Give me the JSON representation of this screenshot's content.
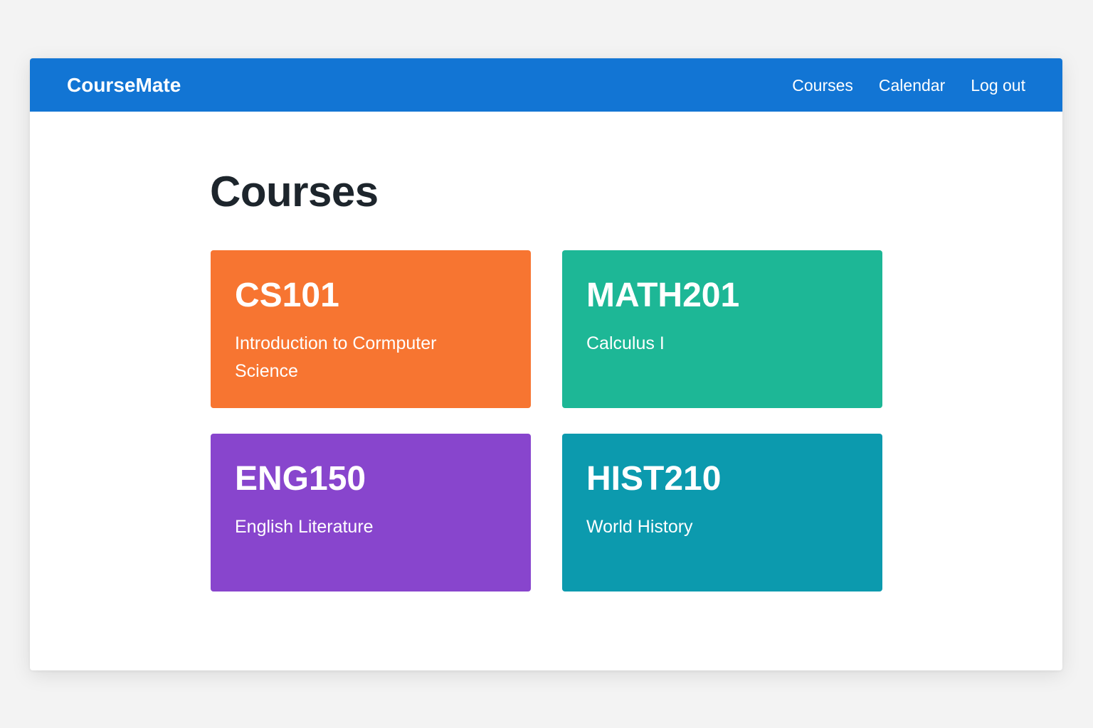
{
  "header": {
    "brand": "CourseMate",
    "nav": [
      {
        "label": "Courses"
      },
      {
        "label": "Calendar"
      },
      {
        "label": "Log out"
      }
    ],
    "background_color": "#1275d4"
  },
  "main": {
    "title": "Courses",
    "courses": [
      {
        "code": "CS101",
        "name": "Introduction to Cormputer Science",
        "color": "#f77531"
      },
      {
        "code": "MATH201",
        "name": "Calculus I",
        "color": "#1db796"
      },
      {
        "code": "ENG150",
        "name": "English Literature",
        "color": "#8845cd"
      },
      {
        "code": "HIST210",
        "name": "World History",
        "color": "#0c9aae"
      }
    ]
  }
}
